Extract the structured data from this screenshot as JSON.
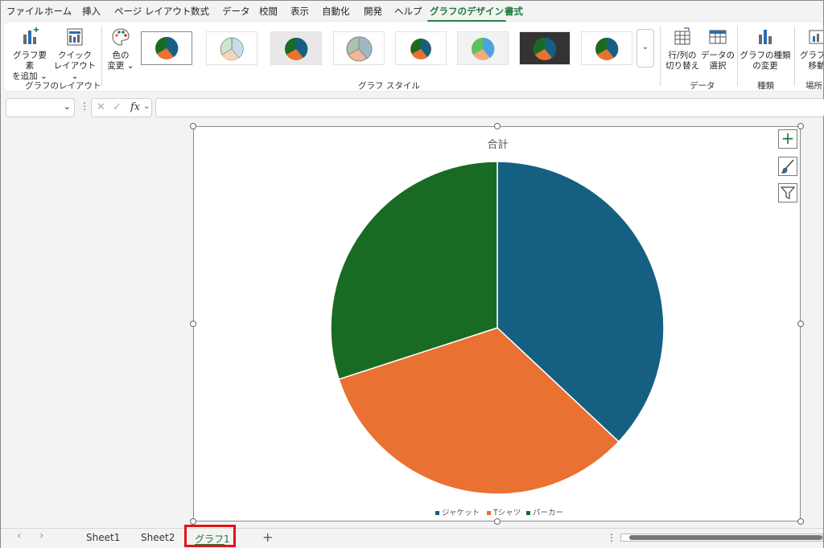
{
  "menu": {
    "tabs": [
      "ファイル",
      "ホーム",
      "挿入",
      "ページ レイアウト",
      "数式",
      "データ",
      "校閲",
      "表示",
      "自動化",
      "開発",
      "ヘルプ",
      "グラフのデザイン",
      "書式"
    ],
    "active_tab": "グラフのデザイン"
  },
  "ribbon": {
    "add_element": {
      "line1": "グラフ要素",
      "line2": "を追加 ⌄"
    },
    "quick_layout": {
      "line1": "クイック",
      "line2": "レイアウト ⌄"
    },
    "group_layout": "グラフのレイアウト",
    "change_colors": {
      "line1": "色の",
      "line2": "変更 ⌄"
    },
    "group_style": "グラフ スタイル",
    "switch_row_col": {
      "line1": "行/列の",
      "line2": "切り替え"
    },
    "select_data": {
      "line1": "データの",
      "line2": "選択"
    },
    "group_data": "データ",
    "change_type": {
      "line1": "グラフの種類",
      "line2": "の変更"
    },
    "group_type": "種類",
    "move_chart": {
      "line1": "グラフの",
      "line2": "移動"
    },
    "group_location": "場所",
    "more_styles": "⌄"
  },
  "formula_bar": {
    "namebox_value": "",
    "namebox_dropdown": "⌄",
    "dots": "⋮",
    "cancel": "✕",
    "enter": "✓",
    "fx": "fx",
    "fx_dropdown": "⌄",
    "formula_value": ""
  },
  "chart_data": {
    "type": "pie",
    "title": "合計",
    "categories": [
      "ジャケット",
      "Tシャツ",
      "パーカー"
    ],
    "values": [
      37,
      33,
      30
    ],
    "colors": [
      "#156082",
      "#e97132",
      "#196b24"
    ],
    "legend_position": "bottom"
  },
  "side_buttons": {
    "plus": "+",
    "brush": "brush-icon",
    "filter": "filter-icon"
  },
  "tabbar": {
    "nav_prev": "‹",
    "nav_next": "›",
    "sheets": [
      "Sheet1",
      "Sheet2",
      "グラフ1"
    ],
    "active_sheet": "グラフ1",
    "add_sheet": "+",
    "menu_dots": "⋮"
  },
  "colors": {
    "accent": "#1d7a3a",
    "highlight": "#e3131b"
  }
}
